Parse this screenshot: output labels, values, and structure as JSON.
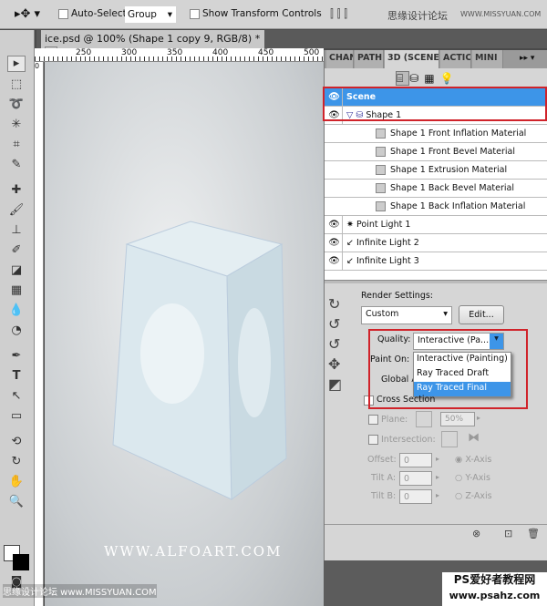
{
  "options_bar": {
    "auto_select_label": "Auto-Select:",
    "auto_select_value": "Group",
    "show_transform_label": "Show Transform Controls",
    "watermark_top": "思缘设计论坛",
    "watermark_url": "WWW.MISSYUAN.COM"
  },
  "document": {
    "tab_title": "ice.psd @ 100% (Shape 1 copy 9, RGB/8) *",
    "ruler_ticks": [
      "250",
      "300",
      "350",
      "400",
      "450",
      "500"
    ],
    "ruler_zero": "0",
    "canvas_watermark": "WWW.ALFOART.COM"
  },
  "panel": {
    "tabs": [
      "CHAN",
      "PATH",
      "3D (SCENE)",
      "ACTIC",
      "MINI"
    ],
    "layers": [
      {
        "name": "Scene",
        "type": "scene",
        "selected": true
      },
      {
        "name": "Shape 1",
        "type": "mesh"
      },
      {
        "name": "Shape 1 Front Inflation Material",
        "type": "material"
      },
      {
        "name": "Shape 1 Front Bevel Material",
        "type": "material"
      },
      {
        "name": "Shape 1 Extrusion Material",
        "type": "material"
      },
      {
        "name": "Shape 1 Back Bevel Material",
        "type": "material"
      },
      {
        "name": "Shape 1 Back Inflation Material",
        "type": "material"
      },
      {
        "name": "Point Light 1",
        "type": "point-light"
      },
      {
        "name": "Infinite Light 2",
        "type": "infinite-light"
      },
      {
        "name": "Infinite Light 3",
        "type": "infinite-light"
      }
    ],
    "render_settings_label": "Render Settings:",
    "preset": "Custom",
    "edit_label": "Edit...",
    "quality_label": "Quality:",
    "quality_value": "Interactive (Pa...",
    "quality_options": [
      "Interactive (Painting)",
      "Ray Traced Draft",
      "Ray Traced Final"
    ],
    "highlighted_option": "Ray Traced Final",
    "paint_on_label": "Paint On:",
    "global_label": "Global A",
    "cross_section_label": "Cross Section",
    "plane_label": "Plane:",
    "plane_value": "50%",
    "intersection_label": "Intersection:",
    "offset_label": "Offset:",
    "offset_value": "0",
    "tilt_a_label": "Tilt A:",
    "tilt_a_value": "0",
    "tilt_b_label": "Tilt B:",
    "tilt_b_value": "0",
    "x_axis": "X-Axis",
    "y_axis": "Y-Axis",
    "z_axis": "Z-Axis"
  },
  "watermarks": {
    "bottom_left": "思缘设计论坛 www.MISSYUAN.COM",
    "bottom_right": "PS爱好者教程网",
    "bottom_right_url": "www.psahz.com"
  },
  "colors": {
    "selection": "#3d95e8",
    "highlight_box": "#d0232a"
  }
}
